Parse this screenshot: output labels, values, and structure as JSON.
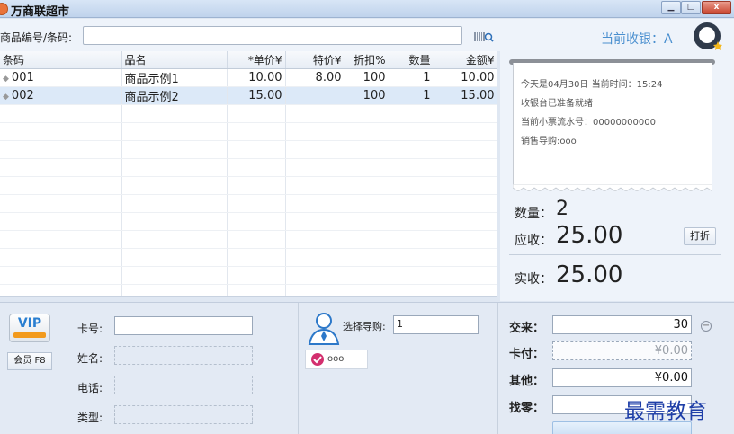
{
  "window": {
    "title": "万商联超市",
    "minimize": "▁",
    "maximize": "□",
    "close": "x"
  },
  "search": {
    "label": "商品编号/条码:",
    "value": "",
    "placeholder": ""
  },
  "cashier": {
    "label": "当前收银：A"
  },
  "table": {
    "columns": [
      "条码",
      "品名",
      "*单价¥",
      "特价¥",
      "折扣%",
      "数量",
      "金额¥"
    ],
    "rows": [
      {
        "code": "001",
        "name": "商品示例1",
        "price": "10.00",
        "special": "8.00",
        "discount": "100",
        "qty": "1",
        "amount": "10.00"
      },
      {
        "code": "002",
        "name": "商品示例2",
        "price": "15.00",
        "special": "",
        "discount": "100",
        "qty": "1",
        "amount": "15.00"
      }
    ]
  },
  "receipt": {
    "line1": "今天是04月30日 当前时间：15:24",
    "line2": "收银台已准备就绪",
    "line3": "当前小票流水号：00000000000",
    "line4": "销售导购:ooo"
  },
  "summary": {
    "qty_label": "数量：",
    "qty_value": "2",
    "due_label": "应收：",
    "due_value": "25.00",
    "discount_button": "打折",
    "paid_label": "实收：",
    "paid_value": "25.00"
  },
  "member": {
    "vip_text": "VIP",
    "member_button": "会员  F8",
    "card_label": "卡号:",
    "name_label": "姓名:",
    "phone_label": "电话:",
    "type_label": "类型:"
  },
  "guide": {
    "label": "选择导购:",
    "value": "1",
    "chip": "ooo"
  },
  "payment": {
    "tendered_label": "交来：",
    "tendered_value": "30",
    "card_label": "卡付：",
    "card_value": "¥0.00",
    "other_label": "其他：",
    "other_value": "¥0.00",
    "change_label": "找零：",
    "change_value": ""
  },
  "watermark": "最需教育",
  "colors": {
    "accent": "#4a8fcf",
    "selected_row": "#dce9f8",
    "vip_stripe": "#f29a1c"
  }
}
